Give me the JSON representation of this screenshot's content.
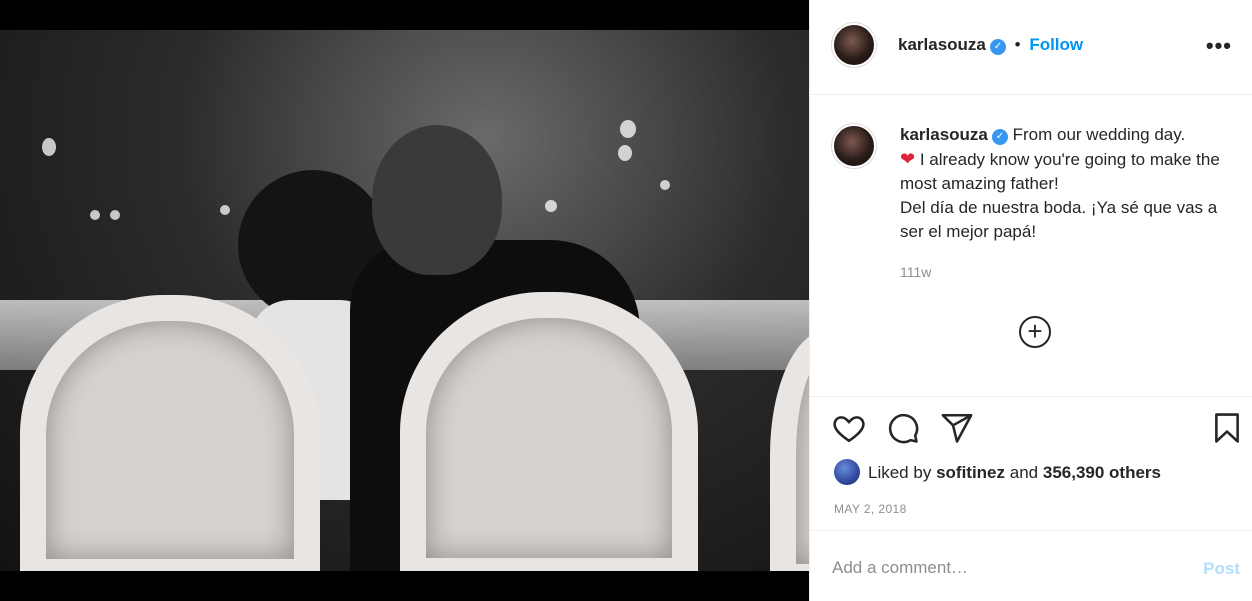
{
  "post": {
    "image_alt": "Black and white photo of a couple kissing at a wedding reception",
    "username": "karlasouza",
    "verified": true,
    "follow_label": "Follow",
    "more_label": "•••",
    "dot": "•",
    "caption": {
      "line1": "From our wedding day.",
      "heart": "❤",
      "line2": " I already know you're going to make the most amazing father!",
      "line3": "Del día de nuestra boda. ¡Ya sé que vas a ser el mejor papá!",
      "time": "111w"
    },
    "load_more_icon": "plus-circle-icon",
    "actions": {
      "like_icon": "heart-icon",
      "comment_icon": "comment-icon",
      "share_icon": "share-icon",
      "save_icon": "bookmark-icon"
    },
    "likes": {
      "prefix": "Liked by",
      "user": "sofitinez",
      "middle": "and",
      "count": "356,390 others"
    },
    "date": "MAY 2, 2018",
    "comment": {
      "placeholder": "Add a comment…",
      "post_label": "Post"
    }
  },
  "colors": {
    "link": "#0095f6",
    "verified": "#3897f0",
    "muted": "#8e8e8e",
    "post_disabled": "#b2dffc"
  }
}
